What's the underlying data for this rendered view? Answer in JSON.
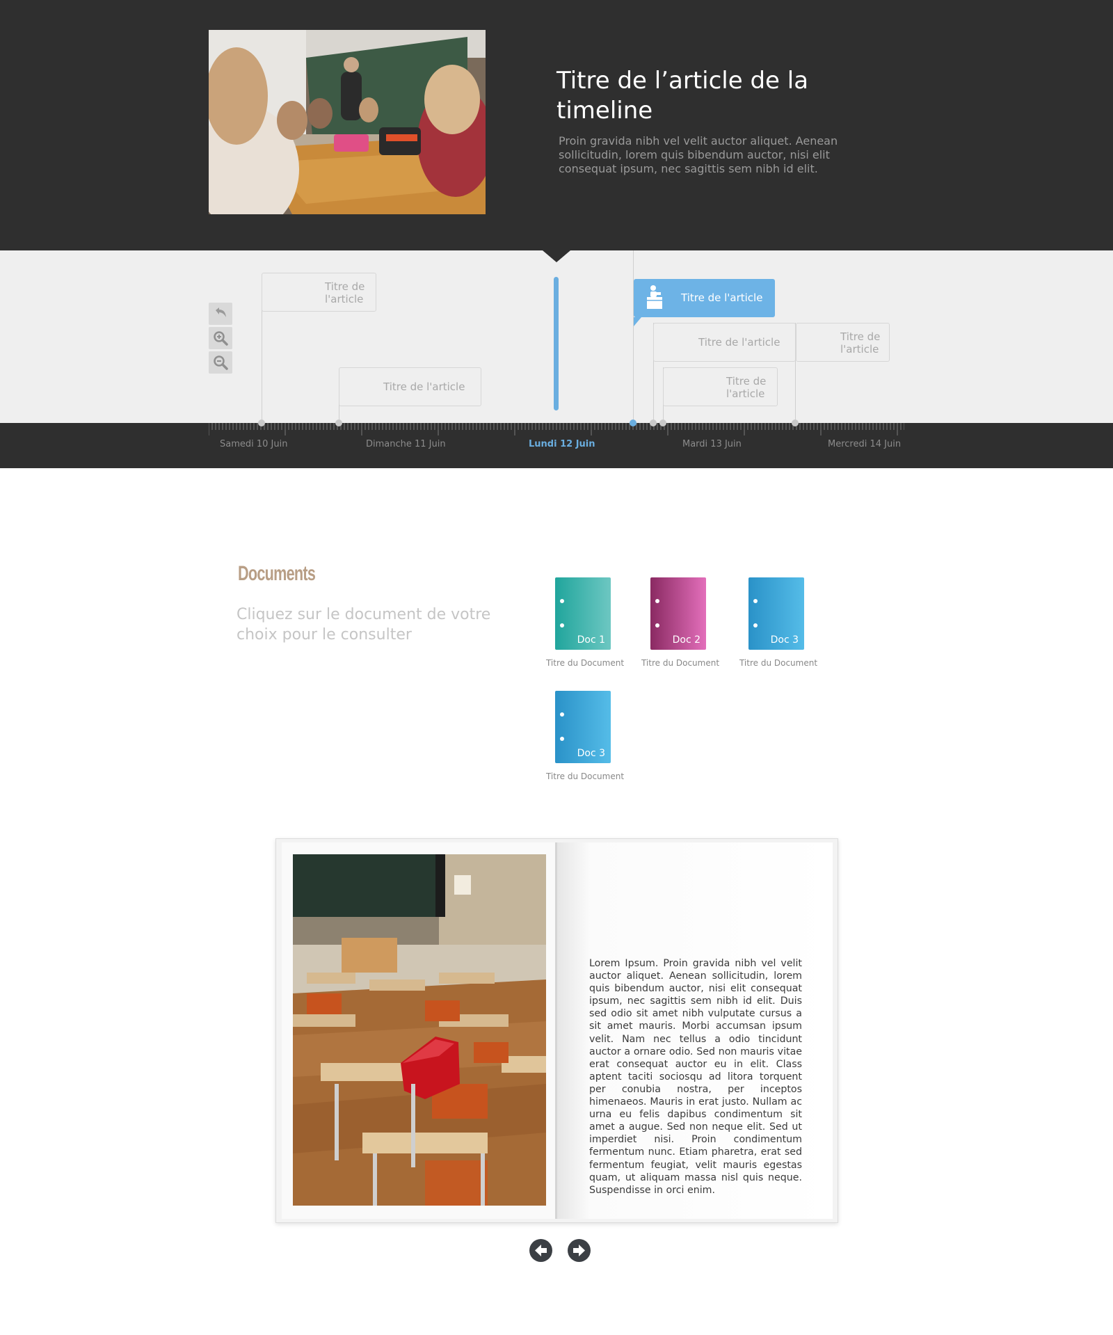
{
  "hero": {
    "title": "Titre de l’article de la timeline",
    "text": "Proin gravida nibh vel velit auctor aliquet. Aenean sollicitudin, lorem quis bibendum auctor, nisi elit consequat ipsum, nec sagittis sem nibh id elit."
  },
  "timeline": {
    "cards": {
      "a1": "Titre de l'article",
      "a2": "Titre de l'article",
      "a3": "Titre de l'article",
      "a4": "Titre de l'article",
      "a5": "Titre de l'article",
      "a6": "Titre de l'article"
    },
    "active_card": "Titre de l'article",
    "days": [
      "Samedi 10 Juin",
      "Dimanche 11 Juin",
      "Lundi 12 Juin",
      "Mardi 13 Juin",
      "Mercredi 14 Juin"
    ],
    "active_day_color": "#6aaee0",
    "accent": "#6db3e6"
  },
  "documents": {
    "title": "Documents",
    "subtitle": "Cliquez sur le document de votre choix pour le consulter",
    "items": [
      {
        "label": "Doc 1",
        "title": "Titre du Document",
        "color": "#3ab0aa"
      },
      {
        "label": "Doc 2",
        "title": "Titre du Document",
        "color": "#c0498f"
      },
      {
        "label": "Doc 3",
        "title": "Titre du Document",
        "color": "#3aa6dc"
      },
      {
        "label": "Doc 3",
        "title": "Titre du Document",
        "color": "#3aa6dc"
      }
    ]
  },
  "book": {
    "text": "Lorem Ipsum. Proin gravida nibh vel velit auctor aliquet. Aenean sollicitudin, lorem quis bibendum auctor, nisi elit consequat ipsum, nec sagittis sem nibh id elit. Duis sed odio sit amet nibh vulputate cursus a sit amet mauris. Morbi accumsan ipsum velit. Nam nec tellus a odio tincidunt auctor a ornare odio. Sed non  mauris vitae erat consequat auctor eu in elit. Class aptent taciti sociosqu ad litora torquent per conubia nostra, per inceptos himenaeos. Mauris in erat justo. Nullam ac urna eu felis dapibus condimentum sit amet a augue. Sed non neque elit. Sed ut imperdiet nisi. Proin condimentum fermentum nunc. Etiam pharetra, erat sed fermentum feugiat, velit mauris egestas quam, ut aliquam massa nisl quis neque. Suspendisse in orci enim."
  }
}
